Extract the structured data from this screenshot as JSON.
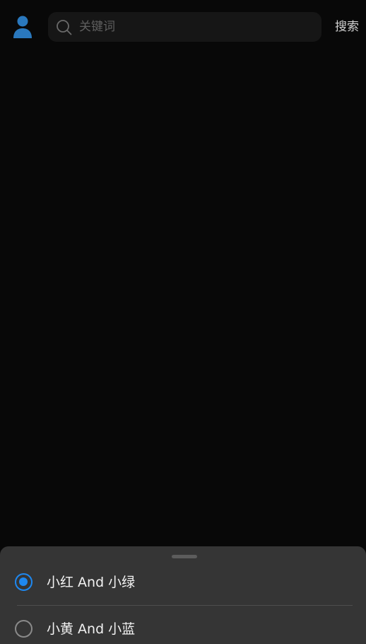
{
  "header": {
    "avatar_icon": "user-avatar-icon",
    "avatar_color": "#2a78bd",
    "search": {
      "icon": "search-icon",
      "placeholder": "关键词",
      "value": ""
    },
    "search_button_label": "搜索"
  },
  "sheet": {
    "accent_color": "#1e88f0",
    "options": [
      {
        "label": "小红 And 小绿",
        "selected": true
      },
      {
        "label": "小黄 And 小蓝",
        "selected": false
      }
    ]
  }
}
